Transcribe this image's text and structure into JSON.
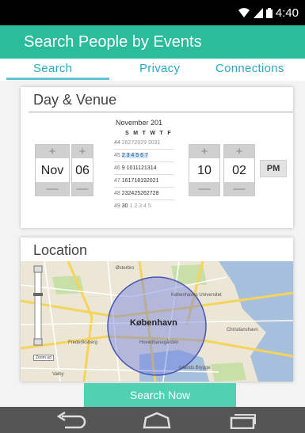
{
  "status_bar": {
    "time": "4:40"
  },
  "app_bar": {
    "title": "Search People by Events"
  },
  "tabs": [
    {
      "label": "Search"
    },
    {
      "label": "Privacy"
    },
    {
      "label": "Connections"
    }
  ],
  "day_venue": {
    "title": "Day & Venue",
    "month": "Nov",
    "day": "06",
    "hour": "10",
    "minute": "02",
    "ampm": "PM",
    "spinner_up": "+",
    "spinner_down": "—",
    "calendar": {
      "title": "November 201",
      "weekdays": "S M T W T F",
      "rows": [
        {
          "week": "44",
          "dates": "26272829 3031",
          "selected": false
        },
        {
          "week": "45",
          "dates": "2 3 4 5 6 7",
          "selected": true
        },
        {
          "week": "46",
          "dates": "9 1011121314",
          "selected": false
        },
        {
          "week": "47",
          "dates": "161718192021",
          "selected": false
        },
        {
          "week": "48",
          "dates": "232425262728",
          "selected": false
        },
        {
          "week": "49",
          "dates": "30",
          "extra": "1 2 3 4 5",
          "selected": false
        }
      ]
    }
  },
  "location": {
    "title": "Location",
    "city_label": "København",
    "zoom_label": "Zoom ud",
    "places": [
      "Østerbro",
      "Københavns Universitet",
      "Frederiksberg",
      "Hovedbanegården",
      "Christianshavn",
      "Islands Brygge",
      "Valby"
    ]
  },
  "search_button": {
    "label": "Search Now"
  },
  "colors": {
    "accent": "#2bbc9b",
    "tab_text": "#2aa9c4",
    "button": "#4fd1b2",
    "radius_fill": "#6f7fe0"
  }
}
